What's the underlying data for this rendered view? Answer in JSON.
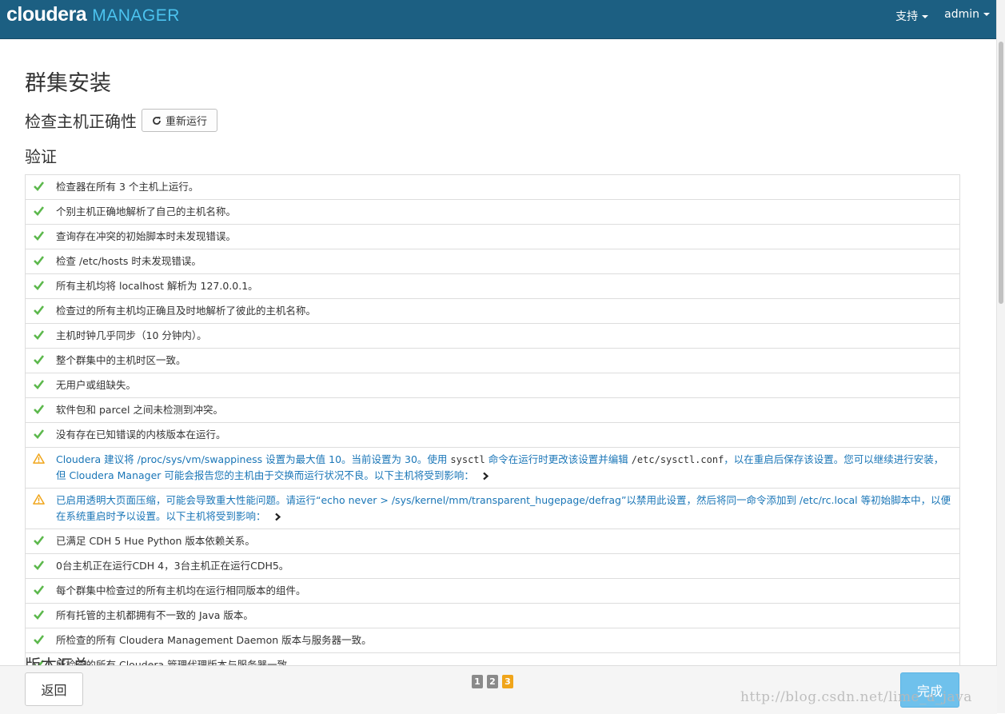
{
  "header": {
    "logo_primary": "cloudera",
    "logo_secondary": "MANAGER",
    "nav": [
      "支持",
      "admin"
    ]
  },
  "page": {
    "title": "群集安装",
    "subtitle": "检查主机正确性",
    "rerun_label": "重新运行",
    "verify_heading": "验证",
    "version_summary_heading": "版本汇总"
  },
  "checks": [
    {
      "status": "ok",
      "text": "检查器在所有 3 个主机上运行。"
    },
    {
      "status": "ok",
      "text": "个别主机正确地解析了自己的主机名称。"
    },
    {
      "status": "ok",
      "text": "查询存在冲突的初始脚本时未发现错误。"
    },
    {
      "status": "ok",
      "text": "检查 /etc/hosts 时未发现错误。"
    },
    {
      "status": "ok",
      "text": "所有主机均将 localhost 解析为 127.0.0.1。"
    },
    {
      "status": "ok",
      "text": "检查过的所有主机均正确且及时地解析了彼此的主机名称。"
    },
    {
      "status": "ok",
      "text": "主机时钟几乎同步（10 分钟内）。"
    },
    {
      "status": "ok",
      "text": "整个群集中的主机时区一致。"
    },
    {
      "status": "ok",
      "text": "无用户或组缺失。"
    },
    {
      "status": "ok",
      "text": "软件包和 parcel 之间未检测到冲突。"
    },
    {
      "status": "ok",
      "text": "没有存在已知错误的内核版本在运行。"
    },
    {
      "status": "warn",
      "parts": [
        {
          "text": "Cloudera 建议将 /proc/sys/vm/swappiness 设置为最大值 10。当前设置为 30。使用 "
        },
        {
          "code": "sysctl"
        },
        {
          "text": " 命令在运行时更改该设置并编辑 "
        },
        {
          "code": "/etc/sysctl.conf"
        },
        {
          "text": "，以在重启后保存该设置。您可以继续进行安装，但 Cloudera Manager 可能会报告您的主机由于交换而运行状况不良。以下主机将受到影响："
        }
      ]
    },
    {
      "status": "warn",
      "parts": [
        {
          "text": "已启用透明大页面压缩，可能会导致重大性能问题。请运行“echo never > /sys/kernel/mm/transparent_hugepage/defrag”以禁用此设置，然后将同一命令添加到 /etc/rc.local 等初始脚本中，以便在系统重启时予以设置。以下主机将受到影响："
        }
      ]
    },
    {
      "status": "ok",
      "text": "已满足 CDH 5 Hue Python 版本依赖关系。"
    },
    {
      "status": "ok",
      "text": "0台主机正在运行CDH 4，3台主机正在运行CDH5。"
    },
    {
      "status": "ok",
      "text": "每个群集中检查过的所有主机均在运行相同版本的组件。"
    },
    {
      "status": "ok",
      "text": "所有托管的主机都拥有不一致的 Java 版本。"
    },
    {
      "status": "ok",
      "text": "所检查的所有 Cloudera Management Daemon 版本与服务器一致。"
    },
    {
      "status": "ok",
      "text": "所检查的所有 Cloudera 管理代理版本与服务器一致。"
    }
  ],
  "footer": {
    "back_label": "返回",
    "steps": [
      "1",
      "2",
      "3"
    ],
    "active_step": 3,
    "finish_label": "完成"
  },
  "watermark": "http://blog.csdn.net/lime_a_java",
  "colors": {
    "header_bg": "#1c5f82",
    "logo_accent": "#4cc3ef",
    "ok_green": "#5cb84c",
    "warn_orange": "#f0a51a",
    "warn_text": "#1a76b7",
    "finish_button": "#6fc1ec"
  }
}
